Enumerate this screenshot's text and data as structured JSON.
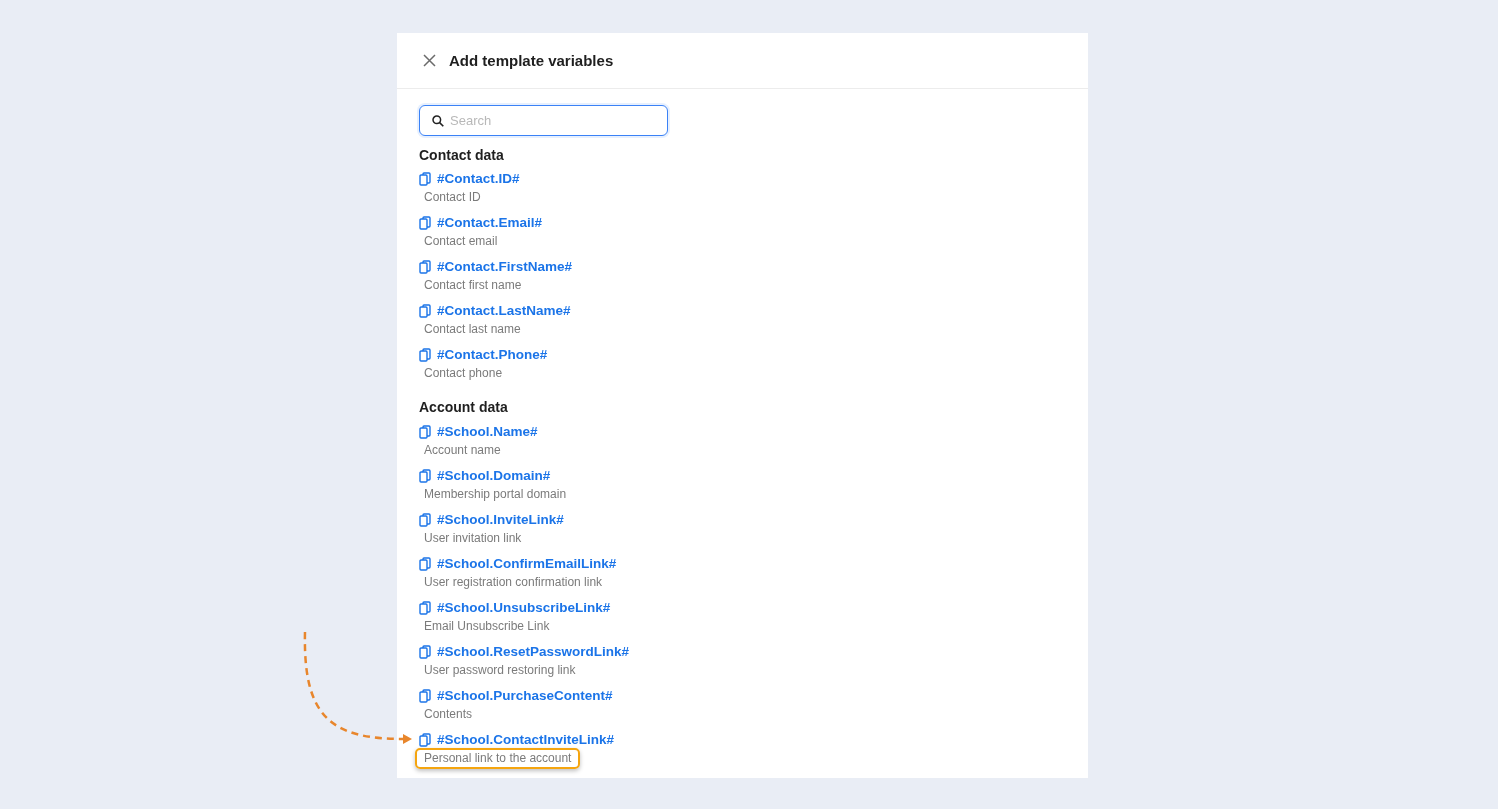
{
  "dialog": {
    "title": "Add template variables"
  },
  "search": {
    "placeholder": "Search"
  },
  "sections": [
    {
      "heading": "Contact data",
      "items": [
        {
          "variable": "#Contact.ID#",
          "description": "Contact ID",
          "highlighted": false
        },
        {
          "variable": "#Contact.Email#",
          "description": "Contact email",
          "highlighted": false
        },
        {
          "variable": "#Contact.FirstName#",
          "description": "Contact first name",
          "highlighted": false
        },
        {
          "variable": "#Contact.LastName#",
          "description": "Contact last name",
          "highlighted": false
        },
        {
          "variable": "#Contact.Phone#",
          "description": "Contact phone",
          "highlighted": false
        }
      ]
    },
    {
      "heading": "Account data",
      "items": [
        {
          "variable": "#School.Name#",
          "description": "Account name",
          "highlighted": false
        },
        {
          "variable": "#School.Domain#",
          "description": "Membership portal domain",
          "highlighted": false
        },
        {
          "variable": "#School.InviteLink#",
          "description": "User invitation link",
          "highlighted": false
        },
        {
          "variable": "#School.ConfirmEmailLink#",
          "description": "User registration confirmation link",
          "highlighted": false
        },
        {
          "variable": "#School.UnsubscribeLink#",
          "description": "Email Unsubscribe Link",
          "highlighted": false
        },
        {
          "variable": "#School.ResetPasswordLink#",
          "description": "User password restoring link",
          "highlighted": false
        },
        {
          "variable": "#School.PurchaseContent#",
          "description": "Contents",
          "highlighted": false
        },
        {
          "variable": "#School.ContactInviteLink#",
          "description": "Personal link to the account",
          "highlighted": true
        }
      ]
    }
  ]
}
